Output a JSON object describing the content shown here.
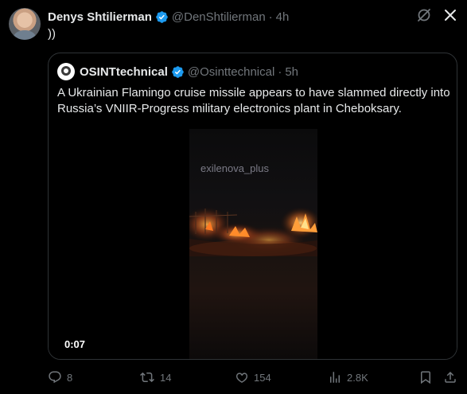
{
  "tweet": {
    "author_name": "Denys Shtilierman",
    "author_handle": "@DenShtilierman",
    "time": "4h",
    "text": "))"
  },
  "quote": {
    "author_name": "OSINTtechnical",
    "author_handle": "@Osinttechnical",
    "time": "5h",
    "text": "A Ukrainian Flamingo cruise missile appears to have slammed directly into Russia’s VNIIR-Progress military electronics plant in Cheboksary.",
    "video": {
      "watermark": "exilenova_plus",
      "duration": "0:07"
    }
  },
  "actions": {
    "replies": "8",
    "reposts": "14",
    "likes": "154",
    "views": "2.8K"
  },
  "colors": {
    "background": "#000000",
    "text": "#e7e9ea",
    "muted": "#71767b",
    "verified": "#1d9bf0",
    "border": "#2f3336"
  },
  "icons": [
    "grok-icon",
    "close-icon",
    "verified-badge-icon",
    "reply-icon",
    "repost-icon",
    "like-icon",
    "views-icon",
    "bookmark-icon",
    "share-icon"
  ]
}
